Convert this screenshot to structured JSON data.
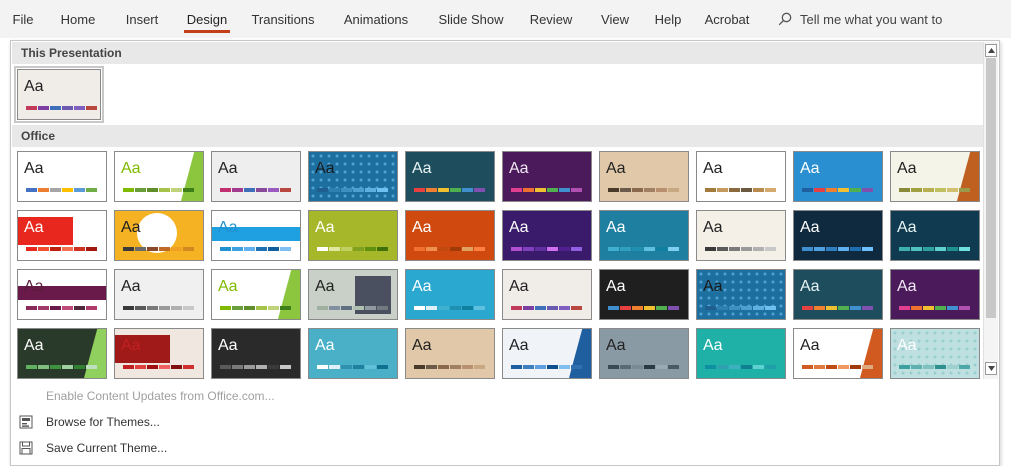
{
  "ribbon": {
    "tabs": [
      "File",
      "Home",
      "Insert",
      "Design",
      "Transitions",
      "Animations",
      "Slide Show",
      "Review",
      "View",
      "Help",
      "Acrobat"
    ],
    "active_tab": "Design",
    "tell_me": "Tell me what you want to"
  },
  "gallery": {
    "this_presentation_header": "This Presentation",
    "office_header": "Office",
    "sample_text": "Aa",
    "current_theme": {
      "bg": "#f0ece8",
      "text": "#222222",
      "swatches": [
        "#c03a5a",
        "#7a3fa0",
        "#3f6fb8",
        "#6a5ab0",
        "#7f5fbf",
        "#b8473f"
      ]
    },
    "themes": [
      {
        "bg": "#ffffff",
        "text": "#222222",
        "swatches": [
          "#4472c4",
          "#ed7d31",
          "#a5a5a5",
          "#ffc000",
          "#5b9bd5",
          "#70ad47"
        ]
      },
      {
        "bg": "#ffffff",
        "text": "#7fba00",
        "accent": "#8cc63f",
        "swatches": [
          "#7fba00",
          "#6b9e3a",
          "#5f8e2a",
          "#a5c249",
          "#c1d37a",
          "#3f7f1a"
        ]
      },
      {
        "bg": "#eeeeee",
        "text": "#222222",
        "swatches": [
          "#c02f6f",
          "#a33a8f",
          "#3f6fb8",
          "#8a4a9a",
          "#9a5abf",
          "#b8473f"
        ]
      },
      {
        "bg": "#1d6fa0",
        "text": "#1a1a1a",
        "pattern": "#5fb1e0",
        "swatches": [
          "#1e5f8f",
          "#2f7fb0",
          "#3f8fc0",
          "#4fa0d0",
          "#5fb0e0",
          "#6fc0f0"
        ]
      },
      {
        "bg": "#1e4e5e",
        "text": "#e8f4f4",
        "swatches": [
          "#e84040",
          "#f08030",
          "#f0c030",
          "#50b050",
          "#4090d0",
          "#8050b0"
        ]
      },
      {
        "bg": "#4a1a5a",
        "text": "#f0e8f4",
        "swatches": [
          "#e0408f",
          "#f07030",
          "#f0c030",
          "#50b050",
          "#4090d0",
          "#b050b0"
        ]
      },
      {
        "bg": "#e0c8a8",
        "text": "#222222",
        "swatches": [
          "#4a3a2a",
          "#6a5a4a",
          "#8a6a4a",
          "#a08060",
          "#b89070",
          "#c8a880"
        ]
      },
      {
        "bg": "#ffffff",
        "text": "#222222",
        "swatches": [
          "#a57a3f",
          "#c49a5f",
          "#8a6a3f",
          "#6a5a3f",
          "#b88a4f",
          "#d4aa6f"
        ]
      },
      {
        "bg": "#2a8fd0",
        "text": "#ffffff",
        "swatches": [
          "#1f5fa0",
          "#e84040",
          "#f08030",
          "#f0c030",
          "#50b050",
          "#8050b0"
        ]
      },
      {
        "bg": "#f4f4e8",
        "text": "#222222",
        "accent": "#c06020",
        "swatches": [
          "#8a8a3a",
          "#a0a040",
          "#b8b050",
          "#c0c060",
          "#d0c070",
          "#9a9a4a"
        ]
      },
      {
        "bg": "#ffffff",
        "text": "#ffffff",
        "block": "#e8281e",
        "swatches": [
          "#e8281e",
          "#f05030",
          "#c02010",
          "#f07050",
          "#d03020",
          "#a01810"
        ]
      },
      {
        "bg": "#f5b223",
        "text": "#222222",
        "circle": "#ffffff",
        "swatches": [
          "#3a3a3a",
          "#6a6a6a",
          "#8a4a2a",
          "#c06a2a",
          "#f0a020",
          "#d08a20"
        ]
      },
      {
        "bg": "#ffffff",
        "text": "#1f90d0",
        "band": "#1fa0e0",
        "swatches": [
          "#1f90d0",
          "#3fa0e0",
          "#5fb0f0",
          "#1f70b0",
          "#0f5f9f",
          "#7fc0f0"
        ]
      },
      {
        "bg": "#a6b729",
        "text": "#ffffff",
        "swatches": [
          "#ffffff",
          "#e0e8a0",
          "#c0d060",
          "#80a020",
          "#609010",
          "#40700a"
        ]
      },
      {
        "bg": "#d04a10",
        "text": "#ffffff",
        "swatches": [
          "#f07030",
          "#f09050",
          "#c04a10",
          "#a03a08",
          "#e0a060",
          "#ff8040"
        ]
      },
      {
        "bg": "#3a1a6a",
        "text": "#ffffff",
        "swatches": [
          "#b050d0",
          "#8040c0",
          "#6030a0",
          "#d070f0",
          "#502090",
          "#9060e0"
        ]
      },
      {
        "bg": "#1f7fa0",
        "text": "#ffffff",
        "swatches": [
          "#3fb0d0",
          "#2fa0c0",
          "#1f90b0",
          "#5fc0e0",
          "#0f80a0",
          "#7fd0f0"
        ]
      },
      {
        "bg": "#f4f0e8",
        "text": "#222222",
        "swatches": [
          "#3a3a3a",
          "#5a5a5a",
          "#7a7a7a",
          "#9a9a9a",
          "#b0b0b0",
          "#c8c8c8"
        ]
      },
      {
        "bg": "#0f2a3f",
        "text": "#ffffff",
        "swatches": [
          "#3f8fd0",
          "#4fa0e0",
          "#2f7fc0",
          "#5fb0f0",
          "#1f6fb0",
          "#6fc0ff"
        ]
      },
      {
        "bg": "#0f3a4f",
        "text": "#e8f4f4",
        "swatches": [
          "#3fb0b0",
          "#4fc0c0",
          "#2fa0a0",
          "#5fd0d0",
          "#1f9090",
          "#6fe0e0"
        ]
      },
      {
        "bg": "#ffffff",
        "text": "#5a1a3a",
        "band": "#6a1a4a",
        "swatches": [
          "#8a2a5a",
          "#a03a6a",
          "#6a1a4a",
          "#c04a7a",
          "#502a3a",
          "#b03a6a"
        ]
      },
      {
        "bg": "#f0f0f0",
        "text": "#222222",
        "swatches": [
          "#3a3a3a",
          "#5a5a5a",
          "#7a7a7a",
          "#9a9a9a",
          "#b0b0b0",
          "#c8c8c8"
        ]
      },
      {
        "bg": "#ffffff",
        "text": "#7fba00",
        "accent": "#8cc63f",
        "swatches": [
          "#7fba00",
          "#6b9e3a",
          "#5f8e2a",
          "#a5c249",
          "#c1d37a",
          "#3f7f1a"
        ]
      },
      {
        "bg": "#c8d0c8",
        "text": "#222222",
        "panel": "#4a5060",
        "swatches": [
          "#a0b0a0",
          "#8090a0",
          "#607080",
          "#b0c0b0",
          "#909aa0",
          "#707a80"
        ]
      },
      {
        "bg": "#2aa8d0",
        "text": "#ffffff",
        "swatches": [
          "#ffffff",
          "#e0f0f8",
          "#3fb0d0",
          "#1f90b0",
          "#0f80a0",
          "#5fc0e0"
        ]
      },
      {
        "bg": "#f0ece8",
        "text": "#222222",
        "swatches": [
          "#c03a5a",
          "#7a3fa0",
          "#3f6fb8",
          "#6a5ab0",
          "#7f5fbf",
          "#b8473f"
        ]
      },
      {
        "bg": "#1f1f1f",
        "text": "#ffffff",
        "swatches": [
          "#3f8fd0",
          "#e84040",
          "#f08030",
          "#f0c030",
          "#50b050",
          "#8050b0"
        ]
      },
      {
        "bg": "#1d6fa0",
        "text": "#1a1a1a",
        "pattern": "#5fb1e0",
        "swatches": [
          "#1e5f8f",
          "#2f7fb0",
          "#3f8fc0",
          "#4fa0d0",
          "#5fb0e0",
          "#6fc0f0"
        ]
      },
      {
        "bg": "#1e4e5e",
        "text": "#e8f4f4",
        "swatches": [
          "#e84040",
          "#f08030",
          "#f0c030",
          "#50b050",
          "#4090d0",
          "#8050b0"
        ]
      },
      {
        "bg": "#4a1a5a",
        "text": "#f0e8f4",
        "swatches": [
          "#e0408f",
          "#f07030",
          "#f0c030",
          "#50b050",
          "#4090d0",
          "#b050b0"
        ]
      },
      {
        "bg": "#2a3a2a",
        "text": "#ffffff",
        "accent": "#8fd05f",
        "swatches": [
          "#5fb05f",
          "#7fc07f",
          "#3f903f",
          "#9fd09f",
          "#2f802f",
          "#bfe0bf"
        ]
      },
      {
        "bg": "#f0e8e0",
        "text": "#c02020",
        "block": "#a01a1a",
        "swatches": [
          "#c02020",
          "#e04040",
          "#a01010",
          "#f06060",
          "#801010",
          "#d03030"
        ]
      },
      {
        "bg": "#2a2a2a",
        "text": "#ffffff",
        "swatches": [
          "#5a5a5a",
          "#7a7a7a",
          "#9a9a9a",
          "#b0b0b0",
          "#3a3a3a",
          "#c8c8c8"
        ]
      },
      {
        "bg": "#4ab0c8",
        "text": "#ffffff",
        "swatches": [
          "#ffffff",
          "#e0f0f8",
          "#2f90b0",
          "#1f80a0",
          "#5fc0d8",
          "#0f7090"
        ]
      },
      {
        "bg": "#e0c8a8",
        "text": "#222222",
        "swatches": [
          "#4a3a2a",
          "#6a5a4a",
          "#8a6a4a",
          "#a08060",
          "#b89070",
          "#c8a880"
        ]
      },
      {
        "bg": "#f0f4f8",
        "text": "#222222",
        "accent": "#1f5fa0",
        "swatches": [
          "#1f5fa0",
          "#3f7fc0",
          "#5f9fe0",
          "#0f4f90",
          "#7fbff0",
          "#2f6fb0"
        ]
      },
      {
        "bg": "#8a9aa4",
        "text": "#222222",
        "swatches": [
          "#3a4a54",
          "#5a6a74",
          "#7a8a94",
          "#2a3a44",
          "#9aaab4",
          "#4a5a64"
        ]
      },
      {
        "bg": "#1fb0a8",
        "text": "#ffffff",
        "swatches": [
          "#0f90a0",
          "#2fa0b0",
          "#3fb0c0",
          "#0f8090",
          "#5fd0d0",
          "#1f9fa8"
        ]
      },
      {
        "bg": "#ffffff",
        "text": "#222222",
        "accent": "#d05a20",
        "swatches": [
          "#d05a20",
          "#e07a40",
          "#c04a10",
          "#f09a60",
          "#a03a08",
          "#e0aa80"
        ]
      },
      {
        "bg": "#bfe0e0",
        "text": "#ffffff",
        "pattern": "#8fc8c8",
        "swatches": [
          "#3fa0a0",
          "#5fb0b0",
          "#7fc0c0",
          "#2f9090",
          "#9fd0d0",
          "#4fa8a8"
        ]
      }
    ]
  },
  "menu": {
    "enable_updates": "Enable Content Updates from Office.com...",
    "browse_themes": "Browse for Themes...",
    "save_theme": "Save Current Theme..."
  }
}
